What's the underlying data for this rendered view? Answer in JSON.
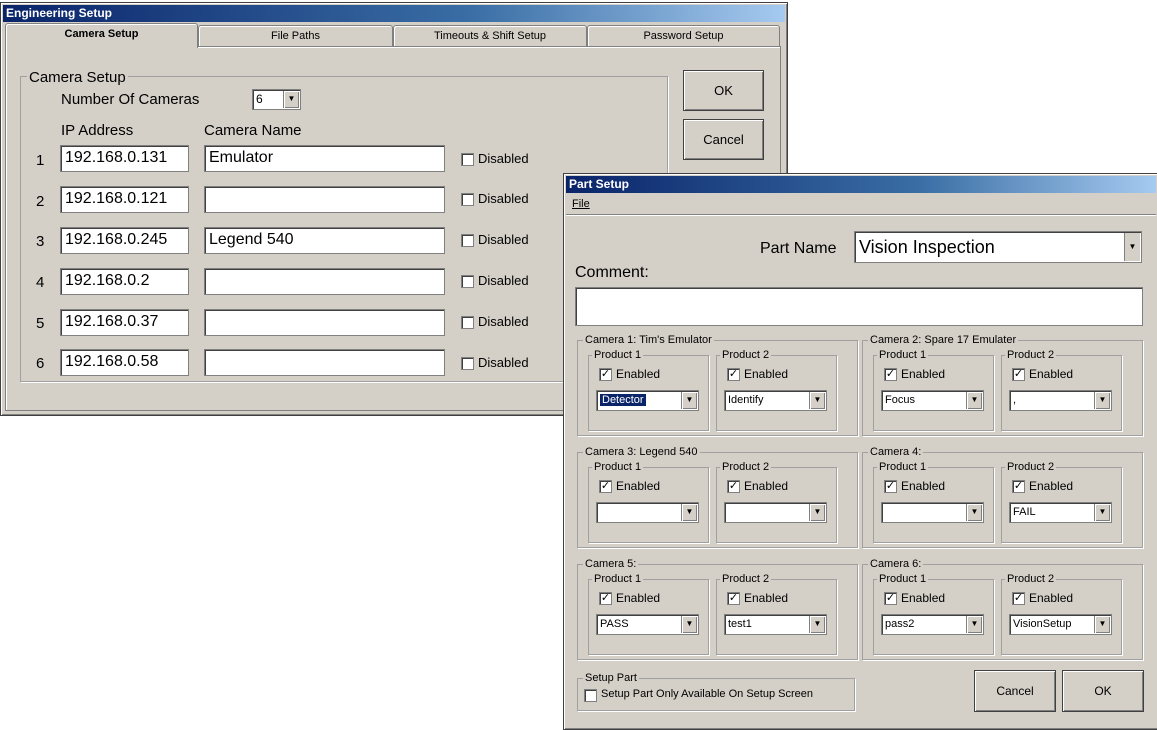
{
  "engineering": {
    "title": "Engineering Setup",
    "tabs": [
      "Camera Setup",
      "File Paths",
      "Timeouts & Shift Setup",
      "Password Setup"
    ],
    "group_label": "Camera Setup",
    "num_cameras_label": "Number Of Cameras",
    "num_cameras_value": "6",
    "ip_header": "IP Address",
    "name_header": "Camera Name",
    "disabled_label": "Disabled",
    "cameras": [
      {
        "num": "1",
        "ip": "192.168.0.131",
        "name": "Emulator"
      },
      {
        "num": "2",
        "ip": "192.168.0.121",
        "name": ""
      },
      {
        "num": "3",
        "ip": "192.168.0.245",
        "name": "Legend 540"
      },
      {
        "num": "4",
        "ip": "192.168.0.2",
        "name": ""
      },
      {
        "num": "5",
        "ip": "192.168.0.37",
        "name": ""
      },
      {
        "num": "6",
        "ip": "192.168.0.58",
        "name": ""
      }
    ],
    "ok_label": "OK",
    "cancel_label": "Cancel"
  },
  "part": {
    "title": "Part Setup",
    "menu_file": "File",
    "part_name_label": "Part Name",
    "part_name_value": "Vision Inspection",
    "comment_label": "Comment:",
    "comment_value": "",
    "product1_label": "Product 1",
    "product2_label": "Product 2",
    "enabled_label": "Enabled",
    "cameras": [
      {
        "label": "Camera 1: Tim's Emulator",
        "p1": "Detector",
        "p2": "Identify"
      },
      {
        "label": "Camera 2: Spare 17 Emulater",
        "p1": "Focus",
        "p2": ","
      },
      {
        "label": "Camera 3: Legend 540",
        "p1": "",
        "p2": ""
      },
      {
        "label": "Camera 4:",
        "p1": "",
        "p2": "FAIL"
      },
      {
        "label": "Camera 5:",
        "p1": "PASS",
        "p2": "test1"
      },
      {
        "label": "Camera 6:",
        "p1": "pass2",
        "p2": "VisionSetup"
      }
    ],
    "setup_group_label": "Setup Part",
    "setup_only_label": "Setup Part Only Available On Setup Screen",
    "cancel_label": "Cancel",
    "ok_label": "OK"
  }
}
